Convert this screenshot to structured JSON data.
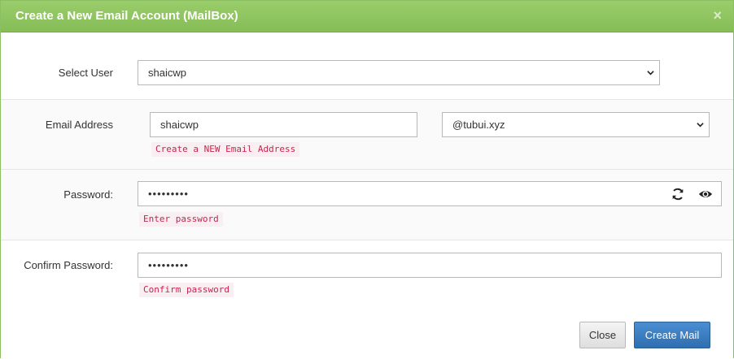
{
  "modal": {
    "title": "Create a New Email Account (MailBox)",
    "close_symbol": "×",
    "header_color": "#8cc460"
  },
  "form": {
    "select_user": {
      "label": "Select User",
      "value": "shaicwp"
    },
    "email_address": {
      "label": "Email Address",
      "value": "shaicwp",
      "domain": "@tubui.xyz",
      "hint": "Create a NEW Email Address"
    },
    "password": {
      "label": "Password:",
      "value": "•••••••••",
      "hint": "Enter password",
      "icons": [
        "refresh-icon",
        "eye-icon"
      ]
    },
    "confirm_password": {
      "label": "Confirm Password:",
      "value": "•••••••••",
      "hint": "Confirm password"
    }
  },
  "footer": {
    "close_label": "Close",
    "create_label": "Create Mail",
    "primary_color": "#3a7cc0"
  }
}
